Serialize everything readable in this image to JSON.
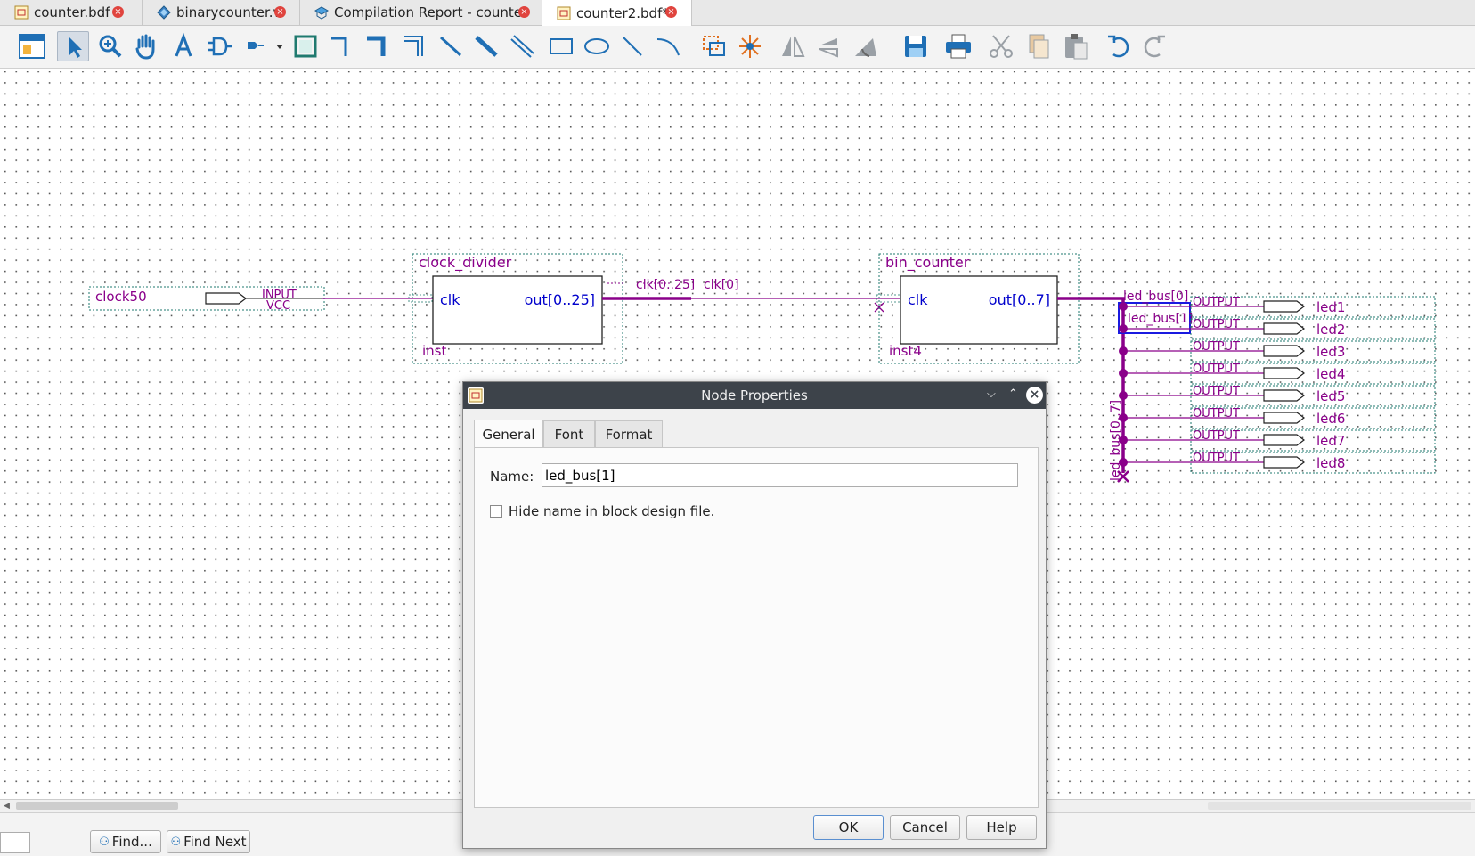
{
  "tabs": [
    {
      "label": "counter.bdf",
      "icon": "bdf-file-icon",
      "closable": true,
      "active": false
    },
    {
      "label": "binarycounter.v",
      "icon": "verilog-file-icon",
      "closable": true,
      "active": false
    },
    {
      "label": "Compilation Report - counter",
      "icon": "report-icon",
      "closable": true,
      "active": false
    },
    {
      "label": "counter2.bdf*",
      "icon": "bdf-file-icon",
      "closable": true,
      "active": true
    }
  ],
  "toolbar": {
    "tools": [
      "detach-window-icon",
      "selection-tool-icon",
      "zoom-tool-icon",
      "hand-tool-icon",
      "text-tool-icon",
      "symbol-tool-icon",
      "pin-tool-icon",
      "block-tool-icon",
      "orthogonal-node-tool-icon",
      "orthogonal-bus-tool-icon",
      "orthogonal-conduit-tool-icon",
      "node-tool-icon",
      "bus-tool-icon",
      "conduit-tool-icon",
      "rectangle-tool-icon",
      "oval-tool-icon",
      "line-tool-icon",
      "arc-tool-icon",
      "partial-line-selection-icon",
      "rubberbanding-icon",
      "flip-horizontal-icon",
      "flip-vertical-icon",
      "rotate-icon",
      "save-icon",
      "print-icon",
      "cut-icon",
      "copy-icon",
      "paste-icon",
      "undo-icon",
      "redo-icon"
    ]
  },
  "schematic": {
    "input_pin": {
      "name": "clock50",
      "type": "INPUT",
      "default": "VCC"
    },
    "block1": {
      "title": "clock_divider",
      "port_in": "clk",
      "port_out": "out[0..25]",
      "instance": "inst"
    },
    "block2": {
      "title": "bin_counter",
      "port_in": "clk",
      "port_out": "out[0..7]",
      "instance": "inst4"
    },
    "bus_label_in": "clk[0..25]",
    "node_label": "clk[0]",
    "led_bus_label": "led_bus[0..7]",
    "led_bus_nodes": [
      "led_bus[0]",
      "led_bus[1]"
    ],
    "outputs": [
      {
        "type": "OUTPUT",
        "name": "led1"
      },
      {
        "type": "OUTPUT",
        "name": "led2"
      },
      {
        "type": "OUTPUT",
        "name": "led3"
      },
      {
        "type": "OUTPUT",
        "name": "led4"
      },
      {
        "type": "OUTPUT",
        "name": "led5"
      },
      {
        "type": "OUTPUT",
        "name": "led6"
      },
      {
        "type": "OUTPUT",
        "name": "led7"
      },
      {
        "type": "OUTPUT",
        "name": "led8"
      }
    ]
  },
  "dialog": {
    "title": "Node Properties",
    "tabs": [
      "General",
      "Font",
      "Format"
    ],
    "active_tab": "General",
    "name_label": "Name:",
    "name_value": "led_bus[1]",
    "hide_label": "Hide name in block design file.",
    "hide_checked": false,
    "ok": "OK",
    "cancel": "Cancel",
    "help": "Help"
  },
  "bottom": {
    "find": "Find...",
    "find_next": "Find Next"
  },
  "colors": {
    "wire": "#8a008a",
    "port": "#0000cc",
    "title_bar": "#3d434a",
    "grid_dot": "#555555"
  }
}
